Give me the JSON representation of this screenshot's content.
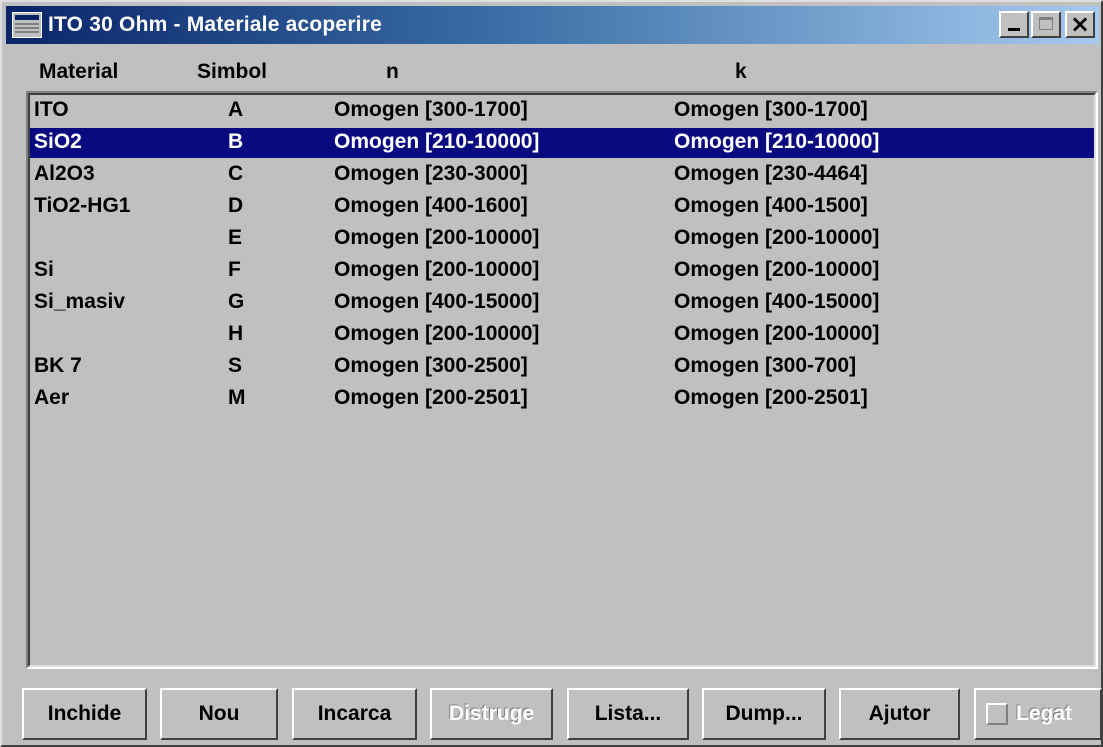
{
  "window": {
    "title": "ITO 30 Ohm - Materiale acoperire"
  },
  "columns": {
    "material": "Material",
    "symbol": "Simbol",
    "n": "n",
    "k": "k"
  },
  "rows": [
    {
      "material": "ITO",
      "symbol": "A",
      "n": "Omogen [300-1700]",
      "k": "Omogen [300-1700]",
      "selected": false
    },
    {
      "material": "SiO2",
      "symbol": "B",
      "n": "Omogen [210-10000]",
      "k": "Omogen [210-10000]",
      "selected": true
    },
    {
      "material": "Al2O3",
      "symbol": "C",
      "n": "Omogen [230-3000]",
      "k": "Omogen [230-4464]",
      "selected": false
    },
    {
      "material": "TiO2-HG1",
      "symbol": "D",
      "n": "Omogen [400-1600]",
      "k": "Omogen [400-1500]",
      "selected": false
    },
    {
      "material": "",
      "symbol": "E",
      "n": "Omogen [200-10000]",
      "k": "Omogen [200-10000]",
      "selected": false
    },
    {
      "material": "Si",
      "symbol": "F",
      "n": "Omogen [200-10000]",
      "k": "Omogen [200-10000]",
      "selected": false
    },
    {
      "material": "Si_masiv",
      "symbol": "G",
      "n": "Omogen [400-15000]",
      "k": "Omogen [400-15000]",
      "selected": false
    },
    {
      "material": "",
      "symbol": "H",
      "n": "Omogen [200-10000]",
      "k": "Omogen [200-10000]",
      "selected": false
    },
    {
      "material": "BK 7",
      "symbol": "S",
      "n": "Omogen [300-2500]",
      "k": "Omogen [300-700]",
      "selected": false
    },
    {
      "material": "Aer",
      "symbol": "M",
      "n": "Omogen [200-2501]",
      "k": "Omogen [200-2501]",
      "selected": false
    }
  ],
  "buttons": {
    "close": "Inchide",
    "new": "Nou",
    "load": "Incarca",
    "destroy": "Distruge",
    "list": "Lista...",
    "dump": "Dump...",
    "help": "Ajutor"
  },
  "checkbox": {
    "label": "Legat",
    "checked": false,
    "enabled": false
  },
  "colors": {
    "selection": "#0a0a80",
    "window_bg": "#c0c0c0",
    "titlebar_start": "#0a246a",
    "titlebar_end": "#a6caf0"
  },
  "icons": {
    "app": "window-app-icon",
    "minimize": "minimize-icon",
    "maximize": "maximize-icon",
    "close": "close-icon"
  }
}
